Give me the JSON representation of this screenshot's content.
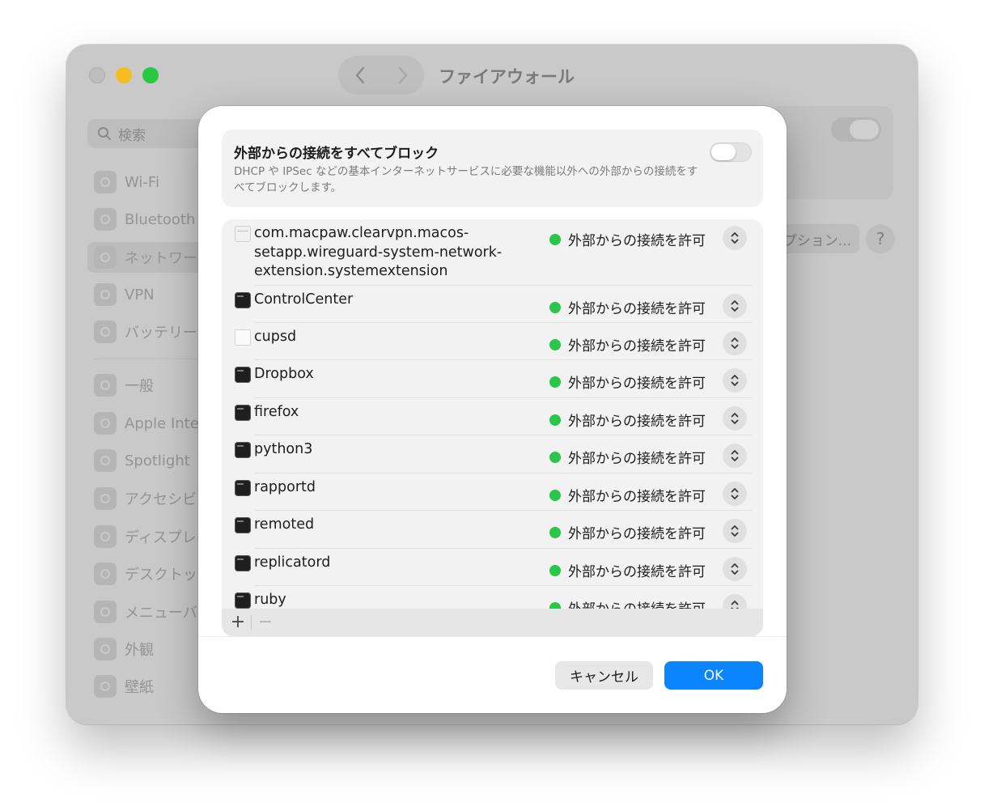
{
  "window": {
    "title": "ファイアウォール",
    "search_placeholder": "検索",
    "sidebar": {
      "items": [
        {
          "label": "Wi-Fi",
          "icon": "wifi-icon",
          "color": "#3a8df0"
        },
        {
          "label": "Bluetooth",
          "icon": "bluetooth-icon",
          "color": "#3a8df0"
        },
        {
          "label": "ネットワーク",
          "icon": "globe-icon",
          "color": "#3a8df0"
        },
        {
          "label": "VPN",
          "icon": "globe-icon",
          "color": "#3a8df0"
        },
        {
          "label": "バッテリー",
          "icon": "battery-icon",
          "color": "#34c759"
        },
        {
          "label": "一般",
          "icon": "gear-icon",
          "color": "#8e8e93"
        },
        {
          "label": "Apple Intelligence",
          "icon": "apple-intelligence-icon",
          "color": "#ffffff"
        },
        {
          "label": "Spotlight",
          "icon": "magnifier-icon",
          "color": "#3a8df0"
        },
        {
          "label": "アクセシビリティ",
          "icon": "accessibility-icon",
          "color": "#3a8df0"
        },
        {
          "label": "ディスプレイ",
          "icon": "sun-icon",
          "color": "#3a8df0"
        },
        {
          "label": "デスクトップとDock",
          "icon": "dock-icon",
          "color": "#1d1d1f"
        },
        {
          "label": "メニューバー",
          "icon": "menubar-icon",
          "color": "#1d1d1f"
        },
        {
          "label": "外観",
          "icon": "appearance-icon",
          "color": "#1d1d1f"
        },
        {
          "label": "壁紙",
          "icon": "flower-icon",
          "color": "#3a8df0"
        }
      ],
      "selected_index": 2
    },
    "options_label": "オプション...",
    "help_label": "?"
  },
  "sheet": {
    "block": {
      "title": "外部からの接続をすべてブロック",
      "description": "DHCP や IPSec などの基本インターネットサービスに必要な機能以外への外部からの接続をすべてブロックします。",
      "enabled": false
    },
    "apps": [
      {
        "name": "com.macpaw.clearvpn.macos-setapp.wireguard-system-network-extension.systemextension",
        "icon": "extension-icon",
        "status": "外部からの接続を許可",
        "status_color": "#2ac64a"
      },
      {
        "name": "ControlCenter",
        "icon": "terminal-exec-icon",
        "status": "外部からの接続を許可",
        "status_color": "#2ac64a"
      },
      {
        "name": "cupsd",
        "icon": "document-icon",
        "status": "外部からの接続を許可",
        "status_color": "#2ac64a"
      },
      {
        "name": "Dropbox",
        "icon": "terminal-exec-icon",
        "status": "外部からの接続を許可",
        "status_color": "#2ac64a"
      },
      {
        "name": "firefox",
        "icon": "terminal-exec-icon",
        "status": "外部からの接続を許可",
        "status_color": "#2ac64a"
      },
      {
        "name": "python3",
        "icon": "terminal-exec-icon",
        "status": "外部からの接続を許可",
        "status_color": "#2ac64a"
      },
      {
        "name": "rapportd",
        "icon": "terminal-exec-icon",
        "status": "外部からの接続を許可",
        "status_color": "#2ac64a"
      },
      {
        "name": "remoted",
        "icon": "terminal-exec-icon",
        "status": "外部からの接続を許可",
        "status_color": "#2ac64a"
      },
      {
        "name": "replicatord",
        "icon": "terminal-exec-icon",
        "status": "外部からの接続を許可",
        "status_color": "#2ac64a"
      },
      {
        "name": "ruby",
        "icon": "terminal-exec-icon",
        "status": "外部からの接続を許可",
        "status_color": "#2ac64a"
      }
    ],
    "footer": {
      "add_label": "+",
      "remove_label": "−"
    },
    "cancel_label": "キャンセル",
    "ok_label": "OK"
  },
  "colors": {
    "accent": "#0a84ff",
    "status_green": "#2ac64a"
  }
}
